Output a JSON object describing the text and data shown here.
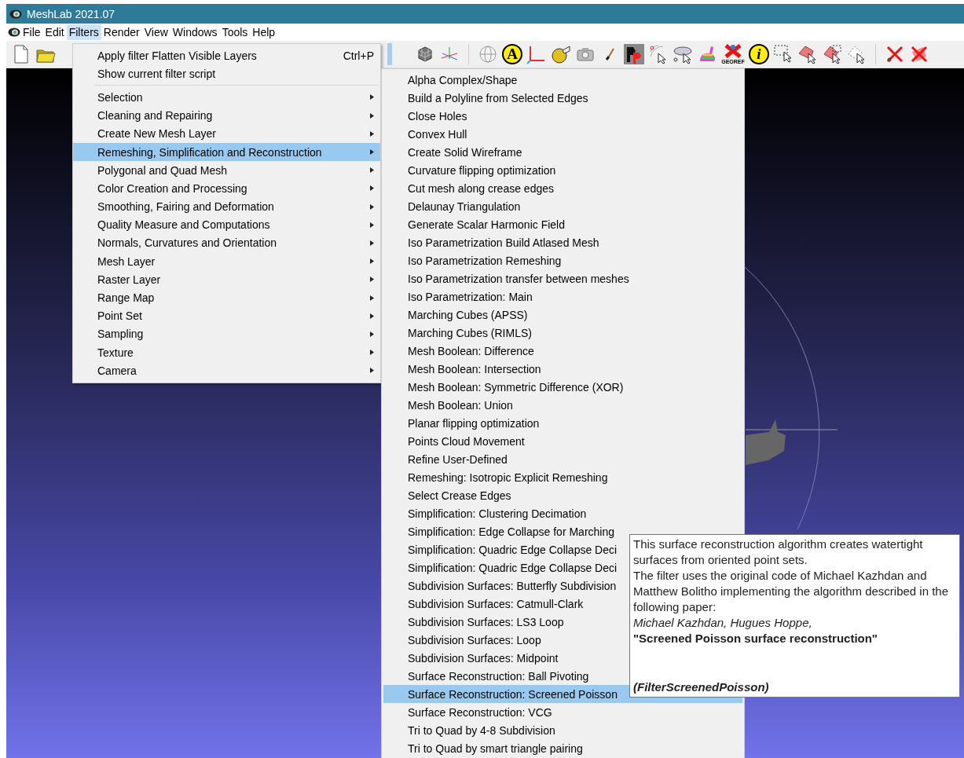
{
  "window": {
    "title": "MeshLab 2021.07"
  },
  "menubar": [
    {
      "label": "File",
      "selected": false
    },
    {
      "label": "Edit",
      "selected": false
    },
    {
      "label": "Filters",
      "selected": true
    },
    {
      "label": "Render",
      "selected": false
    },
    {
      "label": "View",
      "selected": false
    },
    {
      "label": "Windows",
      "selected": false
    },
    {
      "label": "Tools",
      "selected": false
    },
    {
      "label": "Help",
      "selected": false
    }
  ],
  "toolbar": {
    "annotation_letter": "A",
    "info_letter": "i",
    "georef_label": "GEOREF"
  },
  "filters_menu": [
    {
      "kind": "action",
      "label": "Apply filter Flatten Visible Layers",
      "shortcut": "Ctrl+P"
    },
    {
      "kind": "action",
      "label": "Show current filter script"
    },
    {
      "kind": "separator"
    },
    {
      "kind": "submenu",
      "label": "Selection",
      "selected": false
    },
    {
      "kind": "submenu",
      "label": "Cleaning and Repairing",
      "selected": false
    },
    {
      "kind": "submenu",
      "label": "Create New Mesh Layer",
      "selected": false
    },
    {
      "kind": "submenu",
      "label": "Remeshing, Simplification and Reconstruction",
      "selected": true
    },
    {
      "kind": "submenu",
      "label": "Polygonal and Quad Mesh",
      "selected": false
    },
    {
      "kind": "submenu",
      "label": "Color Creation and Processing",
      "selected": false
    },
    {
      "kind": "submenu",
      "label": "Smoothing, Fairing and Deformation",
      "selected": false
    },
    {
      "kind": "submenu",
      "label": "Quality Measure and Computations",
      "selected": false
    },
    {
      "kind": "submenu",
      "label": "Normals, Curvatures and Orientation",
      "selected": false
    },
    {
      "kind": "submenu",
      "label": "Mesh Layer",
      "selected": false
    },
    {
      "kind": "submenu",
      "label": "Raster Layer",
      "selected": false
    },
    {
      "kind": "submenu",
      "label": "Range Map",
      "selected": false
    },
    {
      "kind": "submenu",
      "label": "Point Set",
      "selected": false
    },
    {
      "kind": "submenu",
      "label": "Sampling",
      "selected": false
    },
    {
      "kind": "submenu",
      "label": "Texture",
      "selected": false
    },
    {
      "kind": "submenu",
      "label": "Camera",
      "selected": false
    }
  ],
  "submenu": [
    {
      "label": "Alpha Complex/Shape",
      "selected": false
    },
    {
      "label": "Build a Polyline from Selected Edges",
      "selected": false
    },
    {
      "label": "Close Holes",
      "selected": false
    },
    {
      "label": "Convex Hull",
      "selected": false
    },
    {
      "label": "Create Solid Wireframe",
      "selected": false
    },
    {
      "label": "Curvature flipping optimization",
      "selected": false
    },
    {
      "label": "Cut mesh along crease edges",
      "selected": false
    },
    {
      "label": "Delaunay Triangulation",
      "selected": false
    },
    {
      "label": "Generate Scalar Harmonic Field",
      "selected": false
    },
    {
      "label": "Iso Parametrization Build Atlased Mesh",
      "selected": false
    },
    {
      "label": "Iso Parametrization Remeshing",
      "selected": false
    },
    {
      "label": "Iso Parametrization transfer between meshes",
      "selected": false
    },
    {
      "label": "Iso Parametrization: Main",
      "selected": false
    },
    {
      "label": "Marching Cubes (APSS)",
      "selected": false
    },
    {
      "label": "Marching Cubes (RIMLS)",
      "selected": false
    },
    {
      "label": "Mesh Boolean: Difference",
      "selected": false
    },
    {
      "label": "Mesh Boolean: Intersection",
      "selected": false
    },
    {
      "label": "Mesh Boolean: Symmetric Difference (XOR)",
      "selected": false
    },
    {
      "label": "Mesh Boolean: Union",
      "selected": false
    },
    {
      "label": "Planar flipping optimization",
      "selected": false
    },
    {
      "label": "Points Cloud Movement",
      "selected": false
    },
    {
      "label": "Refine User-Defined",
      "selected": false
    },
    {
      "label": "Remeshing: Isotropic Explicit Remeshing",
      "selected": false
    },
    {
      "label": "Select Crease Edges",
      "selected": false
    },
    {
      "label": "Simplification: Clustering Decimation",
      "selected": false
    },
    {
      "label": "Simplification: Edge Collapse for Marching",
      "selected": false
    },
    {
      "label": "Simplification: Quadric Edge Collapse Deci",
      "selected": false
    },
    {
      "label": "Simplification: Quadric Edge Collapse Deci",
      "selected": false
    },
    {
      "label": "Subdivision Surfaces: Butterfly Subdivision",
      "selected": false
    },
    {
      "label": "Subdivision Surfaces: Catmull-Clark",
      "selected": false
    },
    {
      "label": "Subdivision Surfaces: LS3 Loop",
      "selected": false
    },
    {
      "label": "Subdivision Surfaces: Loop",
      "selected": false
    },
    {
      "label": "Subdivision Surfaces: Midpoint",
      "selected": false
    },
    {
      "label": "Surface Reconstruction: Ball Pivoting",
      "selected": false
    },
    {
      "label": "Surface Reconstruction: Screened Poisson",
      "selected": true
    },
    {
      "label": "Surface Reconstruction: VCG",
      "selected": false
    },
    {
      "label": "Tri to Quad by 4-8 Subdivision",
      "selected": false
    },
    {
      "label": "Tri to Quad by smart triangle pairing",
      "selected": false
    }
  ],
  "tooltip": [
    {
      "kind": "plain",
      "text": "This surface reconstruction algorithm creates watertight surfaces from oriented point sets."
    },
    {
      "kind": "plain",
      "text": "The filter uses the original code of Michael Kazhdan and Matthew Bolitho implementing the algorithm described in the following paper:"
    },
    {
      "kind": "italic",
      "text": "Michael Kazhdan, Hugues Hoppe,"
    },
    {
      "kind": "bold",
      "text": "\"Screened Poisson surface reconstruction\""
    },
    {
      "kind": "gap"
    },
    {
      "kind": "bold_italic",
      "text": "(FilterScreenedPoisson)"
    }
  ]
}
